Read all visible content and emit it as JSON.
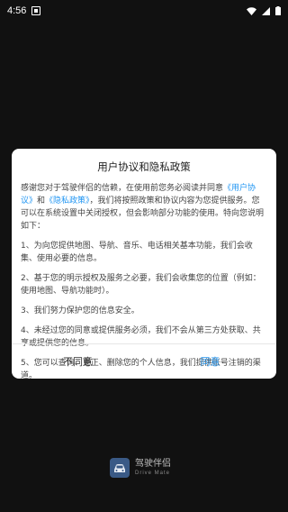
{
  "status_bar": {
    "time": "4:56"
  },
  "dialog": {
    "title": "用户协议和隐私政策",
    "intro_prefix": "感谢您对于驾驶伴侣的信赖，在使用前您务必阅读并同意",
    "link_user_agreement": "《用户协议》",
    "and": "和",
    "link_privacy_policy": "《隐私政策》",
    "intro_suffix": "，我们将按照政策和协议内容为您提供服务。您可以在系统设置中关闭授权，但会影响部分功能的使用。特向您说明如下：",
    "items": [
      "1、为向您提供地图、导航、音乐、电话相关基本功能，我们会收集、使用必要的信息。",
      "2、基于您的明示授权及服务之必要，我们会收集您的位置（例如：使用地图、导航功能时）。",
      "3、我们努力保护您的信息安全。",
      "4、未经过您的同意或提供服务必须，我们不会从第三方处获取、共享或提供您的信息。",
      "5、您可以查询、更正、删除您的个人信息，我们提供账号注销的渠道。"
    ],
    "disagree_label": "不同意",
    "agree_label": "同意"
  },
  "brand": {
    "name": "驾驶伴侣",
    "subtitle": "Drive Mate",
    "icon": "drive-mate-logo-icon"
  },
  "colors": {
    "background": "#111111",
    "link": "#2196f3"
  }
}
